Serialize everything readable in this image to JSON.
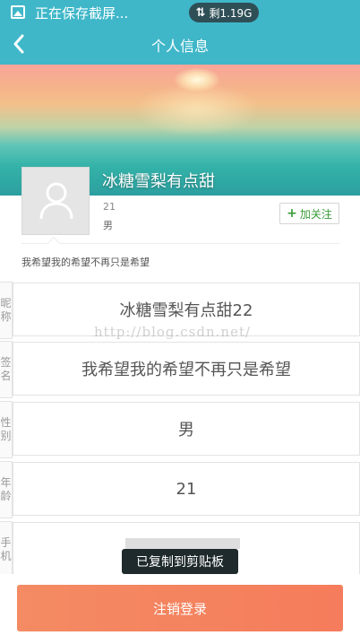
{
  "status_bar": {
    "notification_text": "正在保存截屏...",
    "data_remaining": "剩1.19G"
  },
  "nav": {
    "title": "个人信息"
  },
  "profile": {
    "name": "冰糖雪梨有点甜",
    "age": "21",
    "gender": "男",
    "follow_label": "加关注",
    "signature": "我希望我的希望不再只是希望"
  },
  "fields": [
    {
      "label_line1": "昵",
      "label_line2": "称",
      "value": "冰糖雪梨有点甜22"
    },
    {
      "label_line1": "签",
      "label_line2": "名",
      "value": "我希望我的希望不再只是希望"
    },
    {
      "label_line1": "性",
      "label_line2": "别",
      "value": "男"
    },
    {
      "label_line1": "年",
      "label_line2": "龄",
      "value": "21"
    },
    {
      "label_line1": "手",
      "label_line2": "机",
      "value": ""
    }
  ],
  "watermark": "http://blog.csdn.net/",
  "toast": "已复制到剪贴板",
  "logout_label": "注销登录",
  "colors": {
    "accent": "#3fb7c9",
    "logout": "#f57c5c",
    "follow": "#3a9b3a"
  }
}
